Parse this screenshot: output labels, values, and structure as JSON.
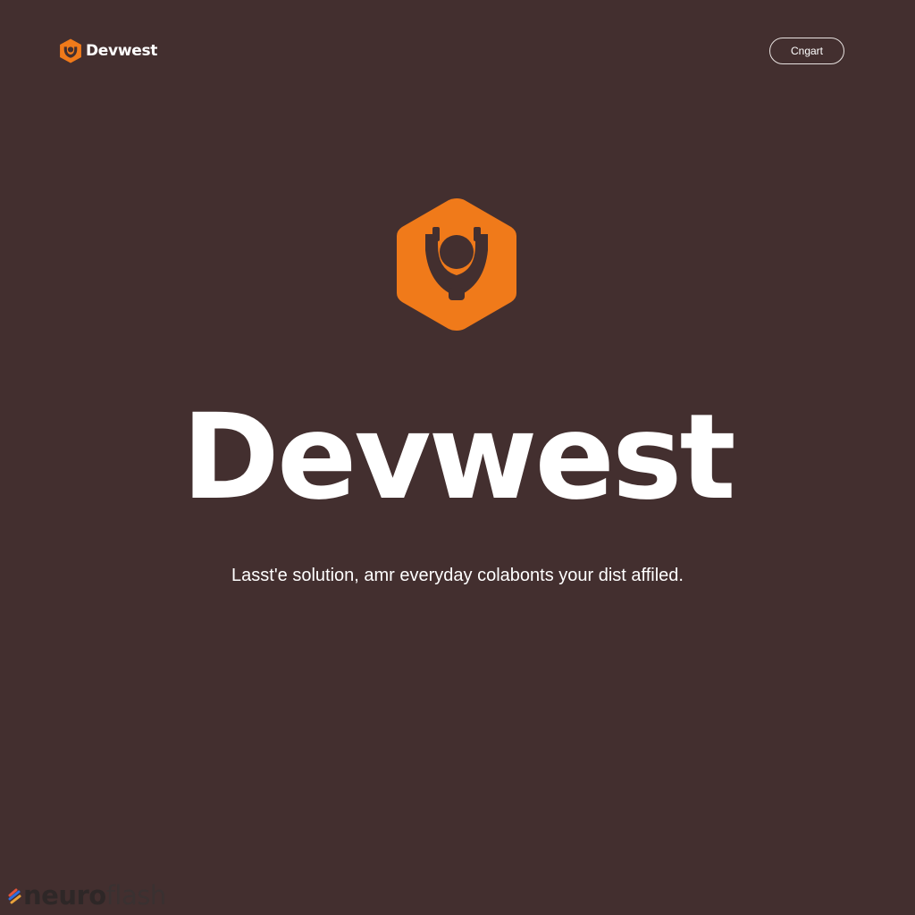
{
  "colors": {
    "background": "#432f2f",
    "accent": "#f07a1a",
    "text": "#ffffff"
  },
  "header": {
    "brand_name": "Devwest",
    "logo_icon": "hexagon-logo-icon",
    "button_label": "Cngart"
  },
  "hero": {
    "logo_icon": "hexagon-logo-icon",
    "title": "Devwest",
    "tagline": "Lasst'e solution, amr everyday colabonts your dist affiled."
  },
  "watermark": {
    "icon": "neuroflash-icon",
    "text_bold": "neuro",
    "text_light": "flash"
  }
}
